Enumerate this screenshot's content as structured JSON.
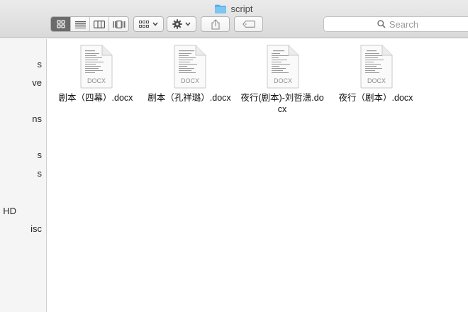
{
  "window": {
    "title": "script",
    "folder_icon": "folder-icon"
  },
  "toolbar": {
    "view_buttons": [
      {
        "name": "icon-view",
        "icon": "grid-icon",
        "active": true
      },
      {
        "name": "list-view",
        "icon": "list-icon",
        "active": false
      },
      {
        "name": "column-view",
        "icon": "columns-icon",
        "active": false
      },
      {
        "name": "coverflow-view",
        "icon": "coverflow-icon",
        "active": false
      }
    ],
    "arrange_icon": "arrange-icon",
    "action_icon": "gear-icon",
    "share_icon": "share-icon",
    "tag_icon": "tag-icon",
    "search": {
      "placeholder": "Search",
      "icon": "search-icon"
    }
  },
  "sidebar": {
    "items": [
      "s",
      "ve",
      "ns",
      "s",
      "s",
      "HD",
      "isc"
    ]
  },
  "files": [
    {
      "name": "剧本（四幕）.docx",
      "kind": "DOCX"
    },
    {
      "name": "剧本（孔祥璐）.docx",
      "kind": "DOCX"
    },
    {
      "name": "夜行(剧本)-刘哲潇.docx",
      "kind": "DOCX"
    },
    {
      "name": "夜行（剧本）.docx",
      "kind": "DOCX"
    }
  ],
  "colors": {
    "folder": "#5bb4ee",
    "active_button": "#6b6b6b",
    "sidebar_bg": "#f5f5f5"
  }
}
